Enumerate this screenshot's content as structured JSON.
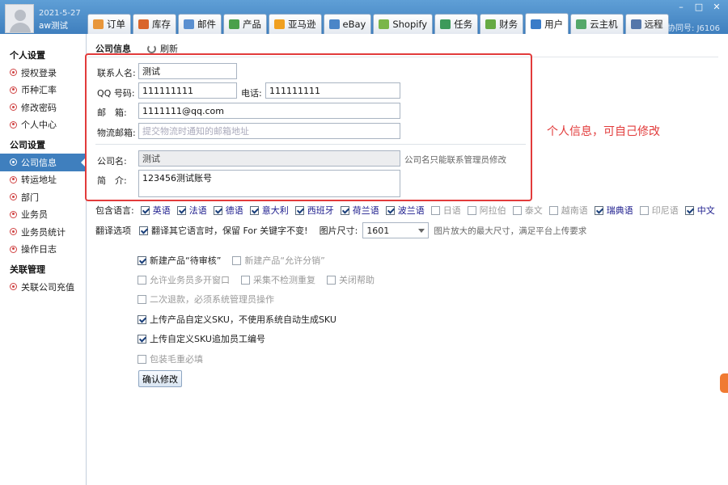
{
  "user": {
    "date": "2021-5-27",
    "name": "aw测试"
  },
  "window": {
    "helper_id": "协同号: J6106"
  },
  "tabs": [
    {
      "label": "订单",
      "color": "#e8963a",
      "active": false
    },
    {
      "label": "库存",
      "color": "#d9652b",
      "active": false
    },
    {
      "label": "邮件",
      "color": "#5a8fd0",
      "active": false
    },
    {
      "label": "产品",
      "color": "#4aa04a",
      "active": false
    },
    {
      "label": "亚马逊",
      "color": "#f0a020",
      "active": false
    },
    {
      "label": "eBay",
      "color": "#4a86c8",
      "active": false
    },
    {
      "label": "Shopify",
      "color": "#7ab648",
      "active": false
    },
    {
      "label": "任务",
      "color": "#3d9a5a",
      "active": false
    },
    {
      "label": "财务",
      "color": "#66aa44",
      "active": false
    },
    {
      "label": "用户",
      "color": "#3a7cc8",
      "active": true
    },
    {
      "label": "云主机",
      "color": "#55a86a",
      "active": false
    },
    {
      "label": "远程",
      "color": "#5577aa",
      "active": false
    }
  ],
  "sidebar": {
    "groups": [
      {
        "title": "个人设置",
        "items": [
          {
            "label": "授权登录"
          },
          {
            "label": "币种汇率"
          },
          {
            "label": "修改密码"
          },
          {
            "label": "个人中心"
          }
        ]
      },
      {
        "title": "公司设置",
        "items": [
          {
            "label": "公司信息",
            "active": true
          },
          {
            "label": "转运地址"
          },
          {
            "label": "部门"
          },
          {
            "label": "业务员"
          },
          {
            "label": "业务员统计"
          },
          {
            "label": "操作日志"
          }
        ]
      },
      {
        "title": "关联管理",
        "items": [
          {
            "label": "关联公司充值"
          }
        ]
      }
    ]
  },
  "main": {
    "title": "公司信息",
    "refresh_label": "刷新",
    "form": {
      "contact_label": "联系人名:",
      "contact_value": "测试",
      "qq_label": "QQ 号码:",
      "qq_value": "111111111",
      "phone_label": "电话:",
      "phone_value": "111111111",
      "email_label": "邮　箱:",
      "email_value": "1111111@qq.com",
      "logistics_email_label": "物流邮箱:",
      "logistics_email_placeholder": "提交物流时通知的邮箱地址",
      "company_label": "公司名:",
      "company_value": "测试",
      "company_hint": "公司名只能联系管理员修改",
      "intro_label": "简　介:",
      "intro_value": "123456测试账号"
    },
    "annotation": "个人信息，可自己修改",
    "languages": {
      "label": "包含语言:",
      "items": [
        {
          "label": "英语",
          "checked": true
        },
        {
          "label": "法语",
          "checked": true
        },
        {
          "label": "德语",
          "checked": true
        },
        {
          "label": "意大利",
          "checked": true
        },
        {
          "label": "西班牙",
          "checked": true
        },
        {
          "label": "荷兰语",
          "checked": true
        },
        {
          "label": "波兰语",
          "checked": true
        },
        {
          "label": "日语",
          "checked": false
        },
        {
          "label": "阿拉伯",
          "checked": false
        },
        {
          "label": "泰文",
          "checked": false
        },
        {
          "label": "越南语",
          "checked": false
        },
        {
          "label": "瑞典语",
          "checked": true
        },
        {
          "label": "印尼语",
          "checked": false
        },
        {
          "label": "中文",
          "checked": true
        }
      ]
    },
    "translate": {
      "label": "翻译选项",
      "option_label": "翻译其它语言时，保留 For 关键字不变!",
      "option_checked": true,
      "image_size_label": "图片尺寸:",
      "image_size_value": "1601",
      "image_size_hint": "图片放大的最大尺寸，满足平台上传要求"
    },
    "options": [
      [
        {
          "label": "新建产品“待审核”",
          "checked": true
        },
        {
          "label": "新建产品“允许分销”",
          "checked": false
        }
      ],
      [
        {
          "label": "允许业务员多开窗口",
          "checked": false
        },
        {
          "label": "采集不检测重复",
          "checked": false
        },
        {
          "label": "关闭帮助",
          "checked": false
        }
      ],
      [
        {
          "label": "二次退款，必须系统管理员操作",
          "checked": false
        }
      ],
      [
        {
          "label": "上传产品自定义SKU，不使用系统自动生成SKU",
          "checked": true
        }
      ],
      [
        {
          "label": "上传自定义SKU追加员工编号",
          "checked": true
        }
      ],
      [
        {
          "label": "包装毛重必填",
          "checked": false
        }
      ]
    ],
    "confirm_label": "确认修改"
  },
  "colors": {
    "accent": "#3f7fbe",
    "annotation": "#e23b3b"
  }
}
